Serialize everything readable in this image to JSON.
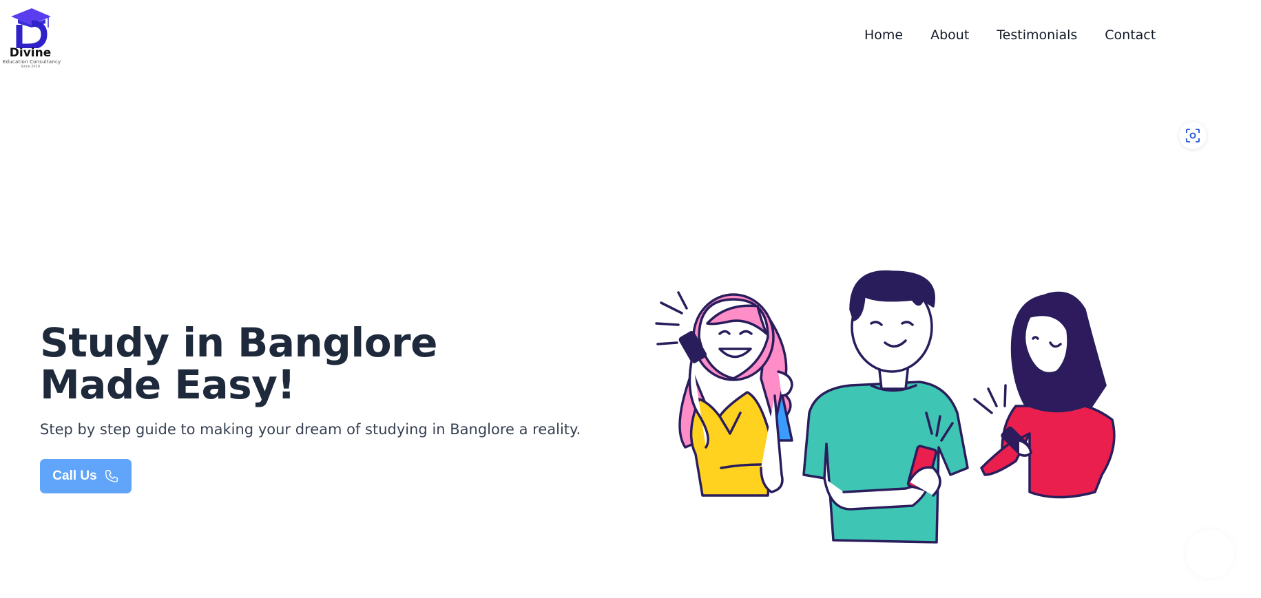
{
  "brand": {
    "name": "Divine",
    "tagline": "Education Consultancy",
    "since": "Since 2019",
    "color": "#3b2ed8"
  },
  "nav": {
    "items": [
      "Home",
      "About",
      "Testimonials",
      "Contact"
    ]
  },
  "hero": {
    "title_line1": "Study in Banglore",
    "title_line2": "Made Easy!",
    "subtitle": "Step by step guide to making your dream of studying in Banglore a reality.",
    "cta_label": "Call Us",
    "cta_icon": "phone-icon",
    "cta_color": "#60a5fa"
  },
  "illustration": {
    "name": "three-people-with-phones"
  },
  "floating": {
    "scan_icon": "scan-icon"
  }
}
